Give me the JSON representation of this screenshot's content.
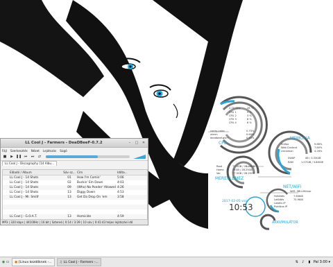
{
  "colors": {
    "accent": "#2aa4d6",
    "window_bg": "#f2f2f2",
    "wallpaper_bg": "#ffffff"
  },
  "window": {
    "title": "LL Cool J - Farmers - DeaDBeeF-0.7.2",
    "menu": [
      "Fájl",
      "Szerkesztés",
      "Nézet",
      "Lejátszás",
      "Súgó"
    ],
    "tab_label": "LL Cool J - Discography [14 Albu...",
    "progress": 0.62,
    "columns": [
      "",
      "Előadó / Album",
      "",
      "Sáv sz...",
      "Cím",
      "Időta..."
    ],
    "rows": [
      {
        "artist": "LL Cool J - 14 Shots To T...",
        "track": "01",
        "title": "How I'm Comin'",
        "time": "5:06"
      },
      {
        "artist": "LL Cool J - 14 Shots To T...",
        "track": "02",
        "title": "Buckin' Em Down",
        "time": "4:03"
      },
      {
        "artist": "LL Cool J - 14 Shots To T...",
        "track": "09",
        "title": "(Who) No Ponder' Allowed",
        "time": "4:26"
      },
      {
        "artist": "LL Cool J - 14 Shots To T...",
        "track": "13",
        "title": "Diggy Down",
        "time": "4:53"
      },
      {
        "artist": "LL Cool J - Mr. Smith",
        "track": "13",
        "title": "Get Da Drop On 'em",
        "time": "3:58"
      },
      {
        "artist": "",
        "track": "",
        "title": "",
        "time": ""
      },
      {
        "artist": "",
        "track": "",
        "title": "",
        "time": ""
      },
      {
        "artist": "",
        "track": "",
        "title": "",
        "time": ""
      },
      {
        "artist": "LL Cool J - G.O.A.T.",
        "track": "13",
        "title": "Homicide",
        "time": "4:59"
      },
      {
        "artist": "LL Cool J - G.O.A.T.",
        "track": "15",
        "title": "Queens Is",
        "time": "4:26"
      },
      {
        "artist": "LL Cool J - G.O.A.T.",
        "track": "19",
        "title": "Shut 'em Down",
        "time": "3:15"
      },
      {
        "artist": "LL Cool J - Todd Smith",
        "track": "01",
        "title": "It's LL And Santana (feat....",
        "time": "3:01"
      }
    ],
    "status": "MP3 | 320 kbps | 44100Hz | 16 bit | Sztereó | 0:14 / 3:39 | 10 sáv | 0:41:43 teljes lejátszási idő"
  },
  "conky": {
    "cpu_freq": "2.70 GHz",
    "cpu_labels": [
      "CPU 1",
      "CPU 2",
      "CPU 3",
      "CPU 4"
    ],
    "cpu_vals": [
      "26 °C",
      "5 %",
      "3 %",
      "8 %",
      "6 %"
    ],
    "procs": [
      "conky-cairo",
      "xterm",
      "deadbeef-gtk+"
    ],
    "proc_vals": [
      "0.75%",
      "0.60%",
      "0.45%"
    ],
    "cpu_title": "CPU",
    "mem_title": "MEMÓRIA",
    "mem_procs": [
      "firefox",
      "Web Content",
      "cinnamon"
    ],
    "mem_vals": [
      "9.86%",
      "7.80%",
      "4.26%"
    ],
    "swap": "SWAP",
    "swap_val": "0B / 3.33GiB",
    "ram": "RAM",
    "ram_val": "1.07GiB / 3.86GiB",
    "disk_title": "MEREVLEMEZ",
    "disk_rows": [
      "Root",
      "Home",
      "Var"
    ],
    "disk_vals": [
      "77.5GB / 28.25GB",
      "74GB / 28.25GB",
      "77.5GB / 28.25GB"
    ],
    "net_title": "NET/WiFi",
    "net_ssid": "WiFi: SBU-Mölnar",
    "net_rows": [
      "Feltöltés",
      "Letöltés",
      "Lokális IP",
      "Publikus IP"
    ],
    "net_vals": [
      "7.60KiB",
      "75.9KiB",
      "",
      ""
    ],
    "date": "2017-02-05 vas",
    "time": "10:53",
    "bat_title": "AKKUMULÁTOR"
  },
  "taskbar": {
    "items": [
      {
        "label": "[Linux kezdőknek -...",
        "icon": "browser-icon"
      },
      {
        "label": "LL Cool J - Farmers -...",
        "icon": "music-icon"
      }
    ],
    "clock": "Pal 3:00 ▾"
  }
}
